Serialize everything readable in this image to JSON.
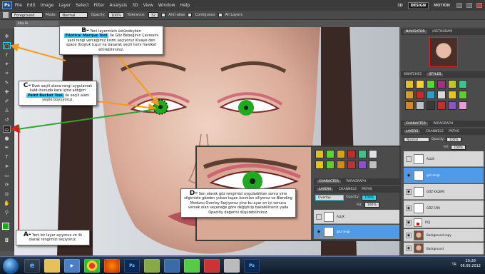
{
  "app": {
    "logo": "Ps",
    "menu": [
      "File",
      "Edit",
      "Image",
      "Layer",
      "Select",
      "Filter",
      "Analysis",
      "3D",
      "View",
      "Window",
      "Help"
    ],
    "workspaces": [
      "3D",
      "DESIGN",
      "MOTION"
    ],
    "active_workspace": "DESIGN"
  },
  "options": {
    "preset": "Foreground",
    "mode_label": "Mode:",
    "mode_value": "Normal",
    "opacity_label": "Opacity:",
    "opacity_value": "100%",
    "tolerance_label": "Tolerance:",
    "tolerance_value": "32",
    "antialias": "Anti-alias",
    "contiguous": "Contiguous",
    "all_layers": "All Layers"
  },
  "document": {
    "tab": "Efsa Fe"
  },
  "callouts": {
    "a": {
      "letter": "A-",
      "text": "Yeni bir layer açıyoruz ve ilk olarak rengimizi seçiyoruz."
    },
    "b": {
      "letter": "B-",
      "text1": "Yeni layermizin üstündeyken",
      "tool": "Eliptical Marque Tool",
      "text2": "ile Göz Bebeğinin Çevresini yani rengi verceğimiz kısmı seçiyoruz Klvaye den space (boşluk tuşu) na basarak seçili lısmı hareket ettirebilirsiniz."
    },
    "c": {
      "letter": "C-",
      "text1": "Evet seçili alana rengi uygulamak kaldı bunuda kare içine aldığım",
      "tool": "Paint Bucket Tool",
      "text2": "ile seçili alanı yeşile boyuyoruz."
    },
    "d": {
      "letter": "D-",
      "text": "Son olarak göz rengimizi uyguladıktan sonra yine silgimizle gözden yukarı taşan kısımları siliyoruz ve Blending Modunu Overlay Seçiyoruz yine bu ayar en iyi sonucu vercek olan seçeneğe göre değiştirip bakabilirsiniz yada Opacitiy değerini düşürebilirsiniz."
    }
  },
  "panels": {
    "navigator_tabs": [
      "NAVIGATOR",
      "HISTOGRAM"
    ],
    "swatch_tabs": [
      "SWATCHES",
      "STYLES"
    ],
    "character_tabs": [
      "CHARACTER",
      "PARAGRAPH"
    ],
    "layers_tabs": [
      "LAYERS",
      "CHANNELS",
      "PATHS"
    ],
    "blend_mode": "Normal",
    "opacity_label": "Opacity:",
    "opacity_value": "100%",
    "fill_label": "Fill:",
    "fill_value": "100%",
    "layers": [
      "ALLIK",
      "göz rengi",
      "GÖZ KALEMI",
      "GÖZ FARI",
      "RUJ",
      "Background copy",
      "Background"
    ]
  },
  "inset": {
    "char_tabs": [
      "CHARACTER",
      "PARAGRAPH"
    ],
    "layers_tabs": [
      "LAYERS",
      "CHANNELS",
      "PATHS"
    ],
    "blend_mode": "Overlay",
    "opacity_label": "Opacity:",
    "opacity_value": "100%",
    "fill_label": "Fill:",
    "fill_value": "100%",
    "layers": [
      "ALLIK",
      "göz rengi"
    ]
  },
  "taskbar": {
    "items": [
      "e",
      "📁",
      "▶",
      "",
      "Ps",
      "",
      "",
      "",
      "",
      "",
      "Ps"
    ],
    "lang": "TR",
    "time": "20:28",
    "date": "06.06.2012"
  },
  "colors": {
    "highlight": "#2ed4f2",
    "eye_green": "#1faa1f",
    "arrow_orange": "#f29b1d",
    "arrow_green": "#2fa52f",
    "arrow_red": "#d52020"
  }
}
